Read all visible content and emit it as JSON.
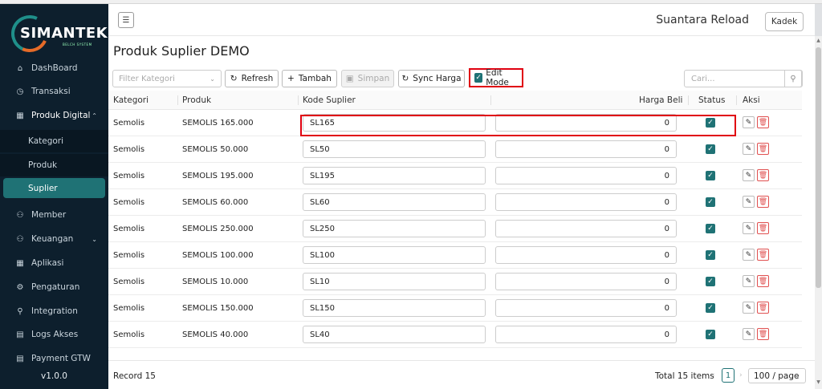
{
  "app": {
    "logo_text": "SIMANTEK",
    "logo_sub": "BELCH SYSTEM",
    "version": "v1.0.0"
  },
  "sidebar": {
    "items": [
      {
        "label": "DashBoard",
        "icon": "home-icon"
      },
      {
        "label": "Transaksi",
        "icon": "clock-icon"
      },
      {
        "label": "Produk Digital",
        "icon": "grid-icon"
      },
      {
        "label": "Member",
        "icon": "users-icon"
      },
      {
        "label": "Keuangan",
        "icon": "users-icon"
      },
      {
        "label": "Aplikasi",
        "icon": "grid-icon"
      },
      {
        "label": "Pengaturan",
        "icon": "gear-icon"
      },
      {
        "label": "Integration",
        "icon": "link-icon"
      },
      {
        "label": "Logs Akses",
        "icon": "file-icon"
      },
      {
        "label": "Payment GTW",
        "icon": "file-icon"
      }
    ],
    "subitems": [
      {
        "label": "Kategori"
      },
      {
        "label": "Produk"
      },
      {
        "label": "Suplier"
      }
    ]
  },
  "header": {
    "brand": "Suantara Reload",
    "user": "Kadek"
  },
  "page": {
    "title": "Produk Suplier DEMO"
  },
  "toolbar": {
    "filter_placeholder": "Filter Kategori",
    "refresh": "Refresh",
    "tambah": "Tambah",
    "simpan": "Simpan",
    "sync": "Sync Harga",
    "edit_mode": "Edit Mode",
    "search_placeholder": "Cari..."
  },
  "table": {
    "headers": {
      "kategori": "Kategori",
      "produk": "Produk",
      "kode": "Kode Suplier",
      "harga": "Harga Beli",
      "status": "Status",
      "aksi": "Aksi"
    },
    "rows": [
      {
        "kategori": "Semolis",
        "produk": "SEMOLIS 165.000",
        "kode": "SL165",
        "harga": "0"
      },
      {
        "kategori": "Semolis",
        "produk": "SEMOLIS 50.000",
        "kode": "SL50",
        "harga": "0"
      },
      {
        "kategori": "Semolis",
        "produk": "SEMOLIS 195.000",
        "kode": "SL195",
        "harga": "0"
      },
      {
        "kategori": "Semolis",
        "produk": "SEMOLIS 60.000",
        "kode": "SL60",
        "harga": "0"
      },
      {
        "kategori": "Semolis",
        "produk": "SEMOLIS 250.000",
        "kode": "SL250",
        "harga": "0"
      },
      {
        "kategori": "Semolis",
        "produk": "SEMOLIS 100.000",
        "kode": "SL100",
        "harga": "0"
      },
      {
        "kategori": "Semolis",
        "produk": "SEMOLIS 10.000",
        "kode": "SL10",
        "harga": "0"
      },
      {
        "kategori": "Semolis",
        "produk": "SEMOLIS 150.000",
        "kode": "SL150",
        "harga": "0"
      },
      {
        "kategori": "Semolis",
        "produk": "SEMOLIS 40.000",
        "kode": "SL40",
        "harga": "0"
      }
    ]
  },
  "footer": {
    "record": "Record 15",
    "total": "Total 15 items",
    "page": "1",
    "page_size": "100 / page"
  },
  "colors": {
    "sidebar": "#0d1f2d",
    "accent": "#1f7275",
    "highlight": "#e00010"
  }
}
